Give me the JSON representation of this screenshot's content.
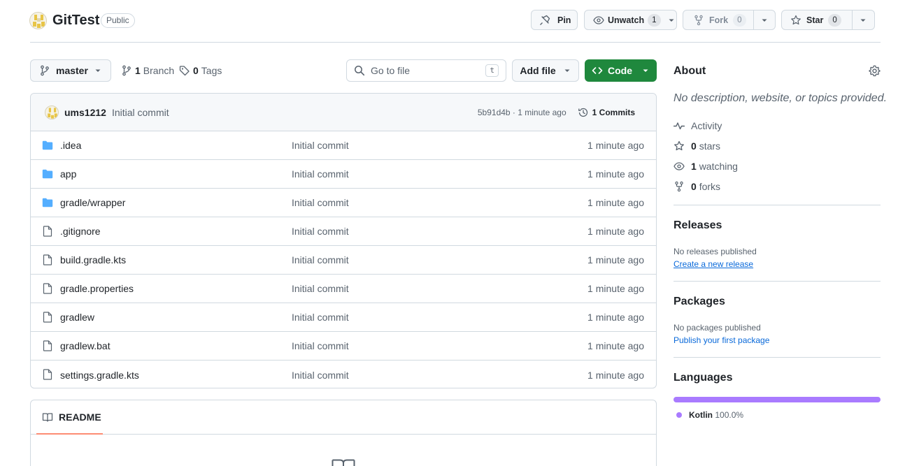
{
  "repo": {
    "name": "GitTest",
    "visibility": "Public"
  },
  "header_actions": {
    "pin_label": "Pin",
    "watch_label": "Unwatch",
    "watch_count": "1",
    "fork_label": "Fork",
    "fork_count": "0",
    "star_label": "Star",
    "star_count": "0"
  },
  "toolbar": {
    "branch": "master",
    "branch_count": "1",
    "branch_word": "Branch",
    "tag_count": "0",
    "tag_word": "Tags",
    "goto_placeholder": "Go to file",
    "goto_shortcut": "t",
    "add_file_label": "Add file",
    "code_label": "Code"
  },
  "latest_commit": {
    "author": "ums1212",
    "message": "Initial commit",
    "meta": "5b91d4b · 1 minute ago",
    "commits_label": "1 Commits"
  },
  "files": [
    {
      "name": ".idea",
      "type": "dir",
      "message": "Initial commit",
      "time": "1 minute ago"
    },
    {
      "name": "app",
      "type": "dir",
      "message": "Initial commit",
      "time": "1 minute ago"
    },
    {
      "name": "gradle/wrapper",
      "type": "dir",
      "message": "Initial commit",
      "time": "1 minute ago"
    },
    {
      "name": ".gitignore",
      "type": "file",
      "message": "Initial commit",
      "time": "1 minute ago"
    },
    {
      "name": "build.gradle.kts",
      "type": "file",
      "message": "Initial commit",
      "time": "1 minute ago"
    },
    {
      "name": "gradle.properties",
      "type": "file",
      "message": "Initial commit",
      "time": "1 minute ago"
    },
    {
      "name": "gradlew",
      "type": "file",
      "message": "Initial commit",
      "time": "1 minute ago"
    },
    {
      "name": "gradlew.bat",
      "type": "file",
      "message": "Initial commit",
      "time": "1 minute ago"
    },
    {
      "name": "settings.gradle.kts",
      "type": "file",
      "message": "Initial commit",
      "time": "1 minute ago"
    }
  ],
  "readme": {
    "tab_label": "README"
  },
  "about": {
    "heading": "About",
    "description": "No description, website, or topics provided.",
    "activity_label": "Activity",
    "stars_count": "0",
    "stars_word": "stars",
    "watching_count": "1",
    "watching_word": "watching",
    "forks_count": "0",
    "forks_word": "forks"
  },
  "releases": {
    "heading": "Releases",
    "empty_text": "No releases published",
    "link": "Create a new release"
  },
  "packages": {
    "heading": "Packages",
    "empty_text": "No packages published",
    "link": "Publish your first package"
  },
  "languages": {
    "heading": "Languages",
    "items": [
      {
        "name": "Kotlin",
        "percent": "100.0%",
        "color": "#a97bff",
        "share": 1.0
      }
    ]
  },
  "colors": {
    "code_button": "#1f883d",
    "folder_icon": "#54aeff",
    "link": "#0969da",
    "readme_underline": "#fd8c73"
  }
}
